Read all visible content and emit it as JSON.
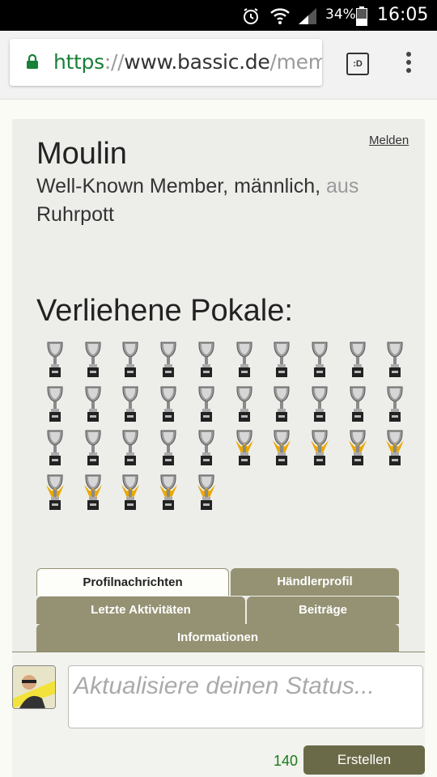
{
  "status_bar": {
    "battery_percent": "34%",
    "time": "16:05",
    "icons": [
      "alarm-icon",
      "wifi-icon",
      "signal-icon",
      "battery-icon"
    ]
  },
  "browser": {
    "url_scheme": "https",
    "url_separator": "://",
    "url_host": "www.bassic.de",
    "url_path": "/mem",
    "tab_switcher_label": ":D"
  },
  "profile": {
    "report_link": "Melden",
    "name": "Moulin",
    "title_line": "Well-Known Member, männlich,",
    "from_label": "aus",
    "location": "Ruhrpott"
  },
  "trophies": {
    "heading": "Verliehene Pokale:",
    "silver_count": 25,
    "gold_count": 10
  },
  "tabs": [
    {
      "label": "Profilnachrichten",
      "active": true
    },
    {
      "label": "Händlerprofil",
      "active": false
    },
    {
      "label": "Letzte Aktivitäten",
      "active": false
    },
    {
      "label": "Beiträge",
      "active": false
    },
    {
      "label": "Informationen",
      "active": false
    }
  ],
  "status_update": {
    "placeholder": "Aktualisiere deinen Status...",
    "char_count": "140",
    "submit_label": "Erstellen"
  },
  "colors": {
    "tab_bg": "#949273",
    "button_bg": "#6b6a48",
    "counter": "#1a7a1a",
    "url_scheme": "#188038"
  }
}
